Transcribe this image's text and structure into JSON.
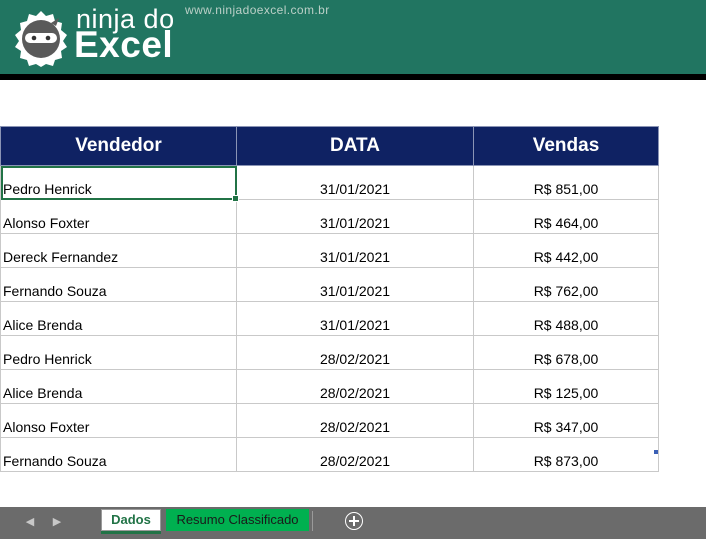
{
  "banner": {
    "brand_small": "ninja do",
    "brand_big": "Excel",
    "site_url": "www.ninjadoexcel.com.br",
    "logo_icon": "ninja-head-icon",
    "bg_color": "#217561"
  },
  "table": {
    "headers": [
      "Vendedor",
      "DATA",
      "Vendas"
    ],
    "rows": [
      [
        "Pedro Henrick",
        "31/01/2021",
        "R$ 851,00"
      ],
      [
        "Alonso Foxter",
        "31/01/2021",
        "R$ 464,00"
      ],
      [
        "Dereck Fernandez",
        "31/01/2021",
        "R$ 442,00"
      ],
      [
        "Fernando Souza",
        "31/01/2021",
        "R$ 762,00"
      ],
      [
        "Alice Brenda",
        "31/01/2021",
        "R$ 488,00"
      ],
      [
        "Pedro Henrick",
        "28/02/2021",
        "R$ 678,00"
      ],
      [
        "Alice Brenda",
        "28/02/2021",
        "R$ 125,00"
      ],
      [
        "Alonso Foxter",
        "28/02/2021",
        "R$ 347,00"
      ],
      [
        "Fernando Souza",
        "28/02/2021",
        "R$ 873,00"
      ]
    ],
    "header_color": "#0f2263",
    "selected_cell": "Pedro Henrick"
  },
  "tabs": {
    "sheets": [
      "Dados",
      "Resumo Classificado"
    ],
    "active": "Dados",
    "resumo_color": "#00b050",
    "nav_prev_icon": "chevron-left-icon",
    "nav_next_icon": "chevron-right-icon",
    "add_icon": "plus-circle-icon"
  }
}
